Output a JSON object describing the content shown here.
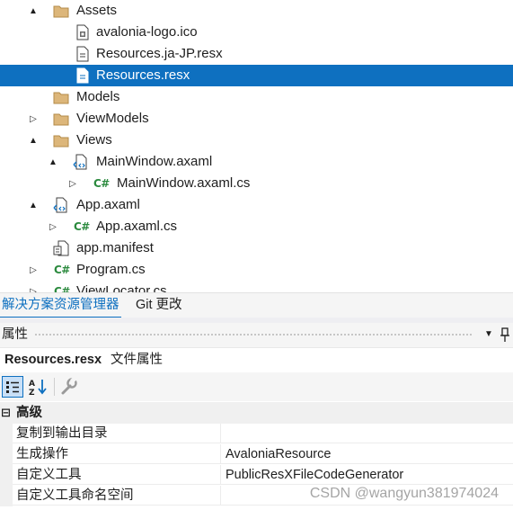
{
  "solution_tree": {
    "items": [
      {
        "label": "Assets",
        "icon": "folder-icon",
        "expander": "▲"
      },
      {
        "label": "avalonia-logo.ico",
        "icon": "ico-file-icon"
      },
      {
        "label": "Resources.ja-JP.resx",
        "icon": "resx-file-icon"
      },
      {
        "label": "Resources.resx",
        "icon": "resx-file-icon",
        "selected": true
      },
      {
        "label": "Models",
        "icon": "folder-icon"
      },
      {
        "label": "ViewModels",
        "icon": "folder-icon",
        "expander": "▷"
      },
      {
        "label": "Views",
        "icon": "folder-icon",
        "expander": "▲"
      },
      {
        "label": "MainWindow.axaml",
        "icon": "axaml-file-icon",
        "expander": "▲"
      },
      {
        "label": "MainWindow.axaml.cs",
        "icon": "csharp-file-icon",
        "expander": "▷"
      },
      {
        "label": "App.axaml",
        "icon": "axaml-file-icon",
        "expander": "▲"
      },
      {
        "label": "App.axaml.cs",
        "icon": "csharp-file-icon",
        "expander": "▷"
      },
      {
        "label": "app.manifest",
        "icon": "manifest-file-icon"
      },
      {
        "label": "Program.cs",
        "icon": "csharp-file-icon",
        "expander": "▷"
      },
      {
        "label": "ViewLocator.cs",
        "icon": "csharp-file-icon",
        "expander": "▷"
      }
    ],
    "csharp_icon_text": "C#",
    "selection_color": "#0e70c0"
  },
  "tabs": [
    {
      "label": "解决方案资源管理器",
      "active": true
    },
    {
      "label": "Git 更改",
      "active": false
    }
  ],
  "properties": {
    "title": "属性",
    "dropdown_glyph": "▼",
    "object_name": "Resources.resx",
    "object_type": "文件属性",
    "category": {
      "toggle": "⊟",
      "label": "高级"
    },
    "rows": [
      {
        "name": "复制到输出目录",
        "value": ""
      },
      {
        "name": "生成操作",
        "value": "AvaloniaResource"
      },
      {
        "name": "自定义工具",
        "value": "PublicResXFileCodeGenerator"
      },
      {
        "name": "自定义工具命名空间",
        "value": ""
      }
    ]
  },
  "watermark": "CSDN @wangyun381974024"
}
